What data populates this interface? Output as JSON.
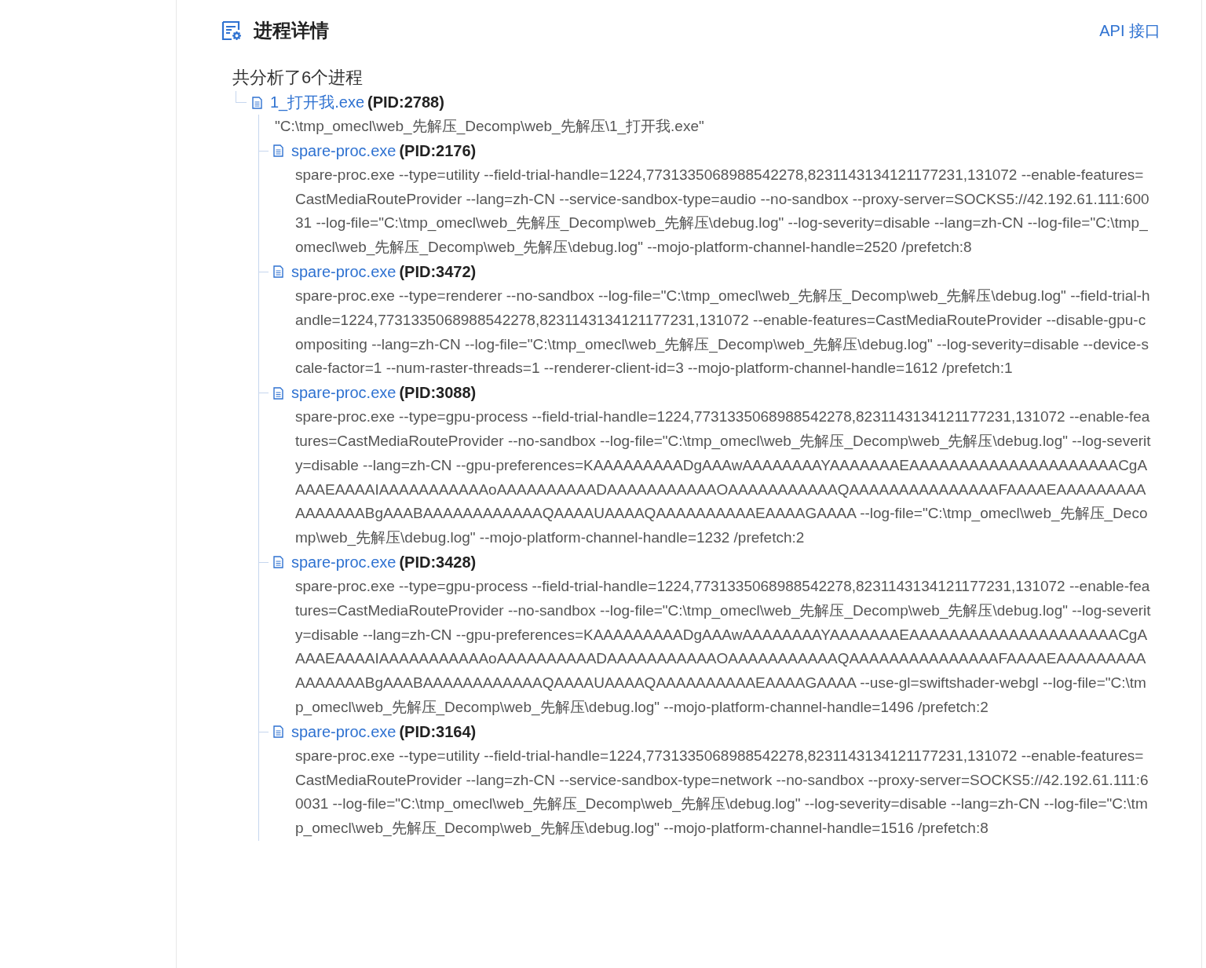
{
  "header": {
    "title": "进程详情",
    "api_link": "API 接口"
  },
  "summary": "共分析了6个进程",
  "processes": [
    {
      "name": "1_打开我.exe",
      "pid": "(PID:2788)",
      "command": "\"C:\\tmp_omecl\\web_先解压_Decomp\\web_先解压\\1_打开我.exe\"",
      "children": [
        {
          "name": "spare-proc.exe",
          "pid": "(PID:2176)",
          "command": "spare-proc.exe --type=utility --field-trial-handle=1224,7731335068988542278,8231143134121177231,131072 --enable-features=CastMediaRouteProvider --lang=zh-CN --service-sandbox-type=audio --no-sandbox --proxy-server=SOCKS5://42.192.61.111:60031 --log-file=\"C:\\tmp_omecl\\web_先解压_Decomp\\web_先解压\\debug.log\" --log-severity=disable --lang=zh-CN --log-file=\"C:\\tmp_omecl\\web_先解压_Decomp\\web_先解压\\debug.log\" --mojo-platform-channel-handle=2520 /prefetch:8"
        },
        {
          "name": "spare-proc.exe",
          "pid": "(PID:3472)",
          "command": "spare-proc.exe --type=renderer --no-sandbox --log-file=\"C:\\tmp_omecl\\web_先解压_Decomp\\web_先解压\\debug.log\" --field-trial-handle=1224,7731335068988542278,8231143134121177231,131072 --enable-features=CastMediaRouteProvider --disable-gpu-compositing --lang=zh-CN --log-file=\"C:\\tmp_omecl\\web_先解压_Decomp\\web_先解压\\debug.log\" --log-severity=disable --device-scale-factor=1 --num-raster-threads=1 --renderer-client-id=3 --mojo-platform-channel-handle=1612 /prefetch:1"
        },
        {
          "name": "spare-proc.exe",
          "pid": "(PID:3088)",
          "command": "spare-proc.exe --type=gpu-process --field-trial-handle=1224,7731335068988542278,8231143134121177231,131072 --enable-features=CastMediaRouteProvider --no-sandbox --log-file=\"C:\\tmp_omecl\\web_先解压_Decomp\\web_先解压\\debug.log\" --log-severity=disable --lang=zh-CN --gpu-preferences=KAAAAAAAAADgAAAwAAAAAAAAYAAAAAAAEAAAAAAAAAAAAAAAAAAAAACgAAAAEAAAAIAAAAAAAAAAAoAAAAAAAAAADAAAAAAAAAAAOAAAAAAAAAAAQAAAAAAAAAAAAAAAFAAAAEAAAAAAAAAAAAAAAABgAAABAAAAAAAAAAAAQAAAAUAAAAQAAAAAAAAAAEAAAAGAAAA --log-file=\"C:\\tmp_omecl\\web_先解压_Decomp\\web_先解压\\debug.log\" --mojo-platform-channel-handle=1232 /prefetch:2"
        },
        {
          "name": "spare-proc.exe",
          "pid": "(PID:3428)",
          "command": "spare-proc.exe --type=gpu-process --field-trial-handle=1224,7731335068988542278,8231143134121177231,131072 --enable-features=CastMediaRouteProvider --no-sandbox --log-file=\"C:\\tmp_omecl\\web_先解压_Decomp\\web_先解压\\debug.log\" --log-severity=disable --lang=zh-CN --gpu-preferences=KAAAAAAAAADgAAAwAAAAAAAAYAAAAAAAEAAAAAAAAAAAAAAAAAAAAACgAAAAEAAAAIAAAAAAAAAAAoAAAAAAAAAADAAAAAAAAAAAOAAAAAAAAAAAQAAAAAAAAAAAAAAAFAAAAEAAAAAAAAAAAAAAAABgAAABAAAAAAAAAAAAQAAAAUAAAAQAAAAAAAAAAEAAAAGAAAA --use-gl=swiftshader-webgl --log-file=\"C:\\tmp_omecl\\web_先解压_Decomp\\web_先解压\\debug.log\" --mojo-platform-channel-handle=1496 /prefetch:2"
        },
        {
          "name": "spare-proc.exe",
          "pid": "(PID:3164)",
          "command": "spare-proc.exe --type=utility --field-trial-handle=1224,7731335068988542278,8231143134121177231,131072 --enable-features=CastMediaRouteProvider --lang=zh-CN --service-sandbox-type=network --no-sandbox --proxy-server=SOCKS5://42.192.61.111:60031 --log-file=\"C:\\tmp_omecl\\web_先解压_Decomp\\web_先解压\\debug.log\" --log-severity=disable --lang=zh-CN --log-file=\"C:\\tmp_omecl\\web_先解压_Decomp\\web_先解压\\debug.log\" --mojo-platform-channel-handle=1516 /prefetch:8"
        }
      ]
    }
  ]
}
